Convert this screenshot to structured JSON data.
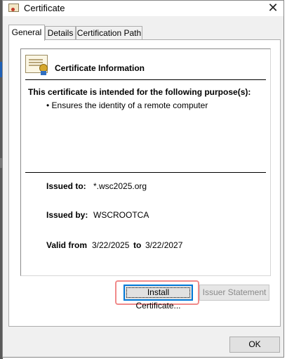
{
  "window": {
    "title": "Certificate",
    "close_glyph": "✕"
  },
  "tabs": [
    {
      "label": "General",
      "active": true
    },
    {
      "label": "Details",
      "active": false
    },
    {
      "label": "Certification Path",
      "active": false
    }
  ],
  "general": {
    "info_title": "Certificate Information",
    "purpose_title": "This certificate is intended for the following purpose(s):",
    "purposes": [
      "• Ensures the identity of a remote computer"
    ],
    "issued_to_label": "Issued to:",
    "issued_to_value": "*.wsc2025.org",
    "issued_by_label": "Issued by:",
    "issued_by_value": "WSCROOTCA",
    "valid_from_label": "Valid from",
    "valid_from_value": "3/22/2025",
    "valid_to_label": "to",
    "valid_to_value": "3/22/2027"
  },
  "buttons": {
    "install": "Install Certificate...",
    "issuer": "Issuer Statement",
    "ok": "OK"
  },
  "icons": {
    "title": "certificate-icon",
    "cert": "certificate-seal-icon",
    "close": "close-icon"
  }
}
